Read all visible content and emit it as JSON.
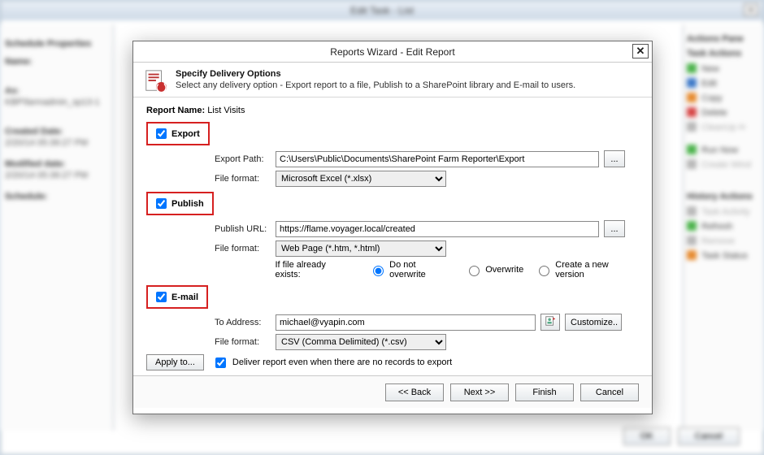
{
  "background": {
    "parent_title": "Edit Task - List",
    "ok": "OK",
    "cancel": "Cancel",
    "actions_pane": "Actions Pane",
    "task_actions": "Task Actions",
    "actions": [
      "New",
      "Edit",
      "Copy",
      "Delete",
      "CleanUp H",
      "Run Now",
      "Create Wind"
    ],
    "history_actions": "History Actions",
    "hist_items": [
      "Task Activity",
      "Refresh",
      "Remove",
      "Task Status"
    ],
    "left_title": "Schedule Properties",
    "left_name_lbl": "Name:",
    "left_as_lbl": "As:",
    "left_as_val": "KBP\\farmadmin_sp13-1",
    "left_created_lbl": "Created Date:",
    "left_created_val": "2/20/14 05:39:27 PM",
    "left_mod_lbl": "Modified date:",
    "left_mod_val": "2/20/14 05:39:27 PM",
    "left_sched_lbl": "Schedule:"
  },
  "dialog": {
    "title": "Reports Wizard - Edit Report",
    "header_title": "Specify Delivery Options",
    "header_sub": "Select any delivery option - Export report to a file, Publish to a SharePoint library and E-mail to users.",
    "report_name_lbl": "Report Name:",
    "report_name": "List Visits",
    "export": {
      "label": "Export",
      "path_lbl": "Export Path:",
      "path": "C:\\Users\\Public\\Documents\\SharePoint Farm Reporter\\Export",
      "browse": "...",
      "fmt_lbl": "File format:",
      "fmt_value": "Microsoft Excel (*.xlsx)"
    },
    "publish": {
      "label": "Publish",
      "url_lbl": "Publish URL:",
      "url": "https://flame.voyager.local/created",
      "browse": "...",
      "fmt_lbl": "File format:",
      "fmt_value": "Web Page (*.htm, *.html)",
      "exists_lbl": "If file already exists:",
      "opt_no_overwrite": "Do not overwrite",
      "opt_overwrite": "Overwrite",
      "opt_newver": "Create a new version"
    },
    "email": {
      "label": "E-mail",
      "to_lbl": "To Address:",
      "to": "michael@vyapin.com",
      "customize": "Customize..",
      "fmt_lbl": "File format:",
      "fmt_value": "CSV (Comma Delimited) (*.csv)"
    },
    "apply_to": "Apply to...",
    "deliver_even": "Deliver report even when there are no records to export",
    "back": "<< Back",
    "next": "Next >>",
    "finish": "Finish",
    "cancel": "Cancel"
  }
}
